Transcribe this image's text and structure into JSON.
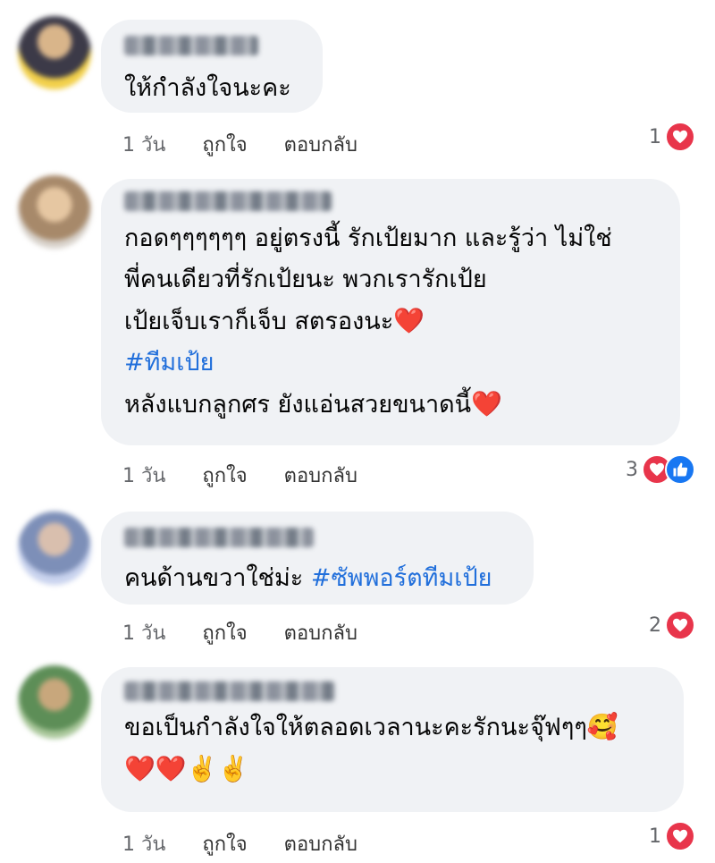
{
  "comments": [
    {
      "lines": [
        {
          "parts": [
            {
              "text": "ให้กำลังใจนะคะ"
            }
          ]
        }
      ],
      "time": "1 วัน",
      "like_label": "ถูกใจ",
      "reply_label": "ตอบกลับ",
      "reaction_count": "1",
      "reactions": [
        "heart-icon"
      ]
    },
    {
      "lines": [
        {
          "parts": [
            {
              "text": "กอดๆๆๆๆๆๆ อยู่ตรงนี้ รักเป้ยมาก และรู้ว่า ไม่ใช่"
            }
          ]
        },
        {
          "parts": [
            {
              "text": "พี่คนเดียวที่รักเป้ยนะ พวกเรารักเป้ย"
            }
          ]
        },
        {
          "parts": [
            {
              "text": "เป้ยเจ็บเราก็เจ็บ สตรองนะ"
            },
            {
              "text": "❤️",
              "emoji": true
            }
          ]
        },
        {
          "parts": [
            {
              "text": "#ทีมเป้ย",
              "hashtag": true
            }
          ]
        },
        {
          "parts": [
            {
              "text": "หลังแบกลูกศร ยังแอ่นสวยขนาดนี้"
            },
            {
              "text": "❤️",
              "emoji": true
            }
          ]
        }
      ],
      "time": "1 วัน",
      "like_label": "ถูกใจ",
      "reply_label": "ตอบกลับ",
      "reaction_count": "3",
      "reactions": [
        "heart-icon",
        "thumbs-up-icon"
      ]
    },
    {
      "lines": [
        {
          "parts": [
            {
              "text": "คนด้านขวาใช่ม่ะ "
            },
            {
              "text": "#ซัพพอร์ตทีมเป้ย",
              "hashtag": true
            }
          ]
        }
      ],
      "time": "1 วัน",
      "like_label": "ถูกใจ",
      "reply_label": "ตอบกลับ",
      "reaction_count": "2",
      "reactions": [
        "heart-icon"
      ]
    },
    {
      "lines": [
        {
          "parts": [
            {
              "text": "ขอเป็นกำลังใจให้ตลอดเวลานะคะรักนะจุ๊ฟๆๆ"
            },
            {
              "text": "🥰",
              "emoji": true
            }
          ]
        },
        {
          "parts": [
            {
              "text": "❤️❤️✌️✌️",
              "emoji": true
            }
          ]
        }
      ],
      "time": "1 วัน",
      "like_label": "ถูกใจ",
      "reply_label": "ตอบกลับ",
      "reaction_count": "1",
      "reactions": [
        "heart-icon"
      ]
    }
  ],
  "colors": {
    "bubble": "#f0f2f5",
    "hashtag": "#216fdb",
    "heart": "#e8354b",
    "like": "#1877f2",
    "meta": "#65676b"
  }
}
